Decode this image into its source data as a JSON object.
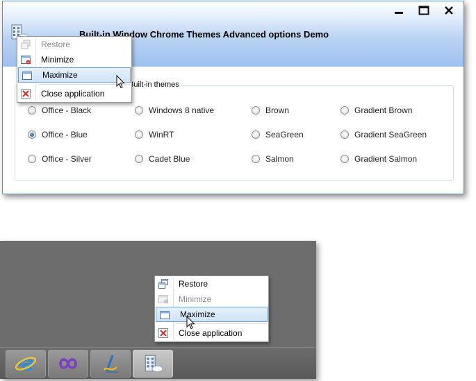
{
  "window": {
    "title": "Built-in Window Chrome Themes Advanced options Demo",
    "group_label": "Built-in themes",
    "themes": [
      [
        "Office - Black",
        "Windows 8 native",
        "Brown",
        "Gradient Brown"
      ],
      [
        "Office - Blue",
        "WinRT",
        "SeaGreen",
        "Gradient SeaGreen"
      ],
      [
        "Office - Silver",
        "Cadet Blue",
        "Salmon",
        "Gradient Salmon"
      ]
    ],
    "selected_theme": "Office - Blue"
  },
  "menu_top": {
    "items": [
      {
        "label": "Restore",
        "icon": "restore-icon",
        "disabled": true
      },
      {
        "label": "Minimize",
        "icon": "minimize-icon",
        "disabled": false
      },
      {
        "label": "Maximize",
        "icon": "maximize-icon",
        "disabled": false,
        "highlighted": true
      },
      {
        "label": "Close application",
        "icon": "close-icon",
        "disabled": false
      }
    ]
  },
  "menu_bottom": {
    "items": [
      {
        "label": "Restore",
        "icon": "restore-icon",
        "disabled": false
      },
      {
        "label": "Minimize",
        "icon": "minimize-icon",
        "disabled": true
      },
      {
        "label": "Maximize",
        "icon": "maximize-icon",
        "disabled": false,
        "highlighted": true
      },
      {
        "label": "Close application",
        "icon": "close-icon",
        "disabled": false
      }
    ]
  },
  "taskbar": {
    "buttons": [
      "internet-explorer-icon",
      "visual-studio-icon",
      "blend-icon",
      "demo-app-icon"
    ],
    "active": "demo-app-icon"
  },
  "colors": {
    "chrome_gradient_bottom": "#9cc0ee",
    "highlight": "#cfe3f8",
    "highlight_border": "#6fa1d8",
    "desktop": "#6d6d6d"
  }
}
